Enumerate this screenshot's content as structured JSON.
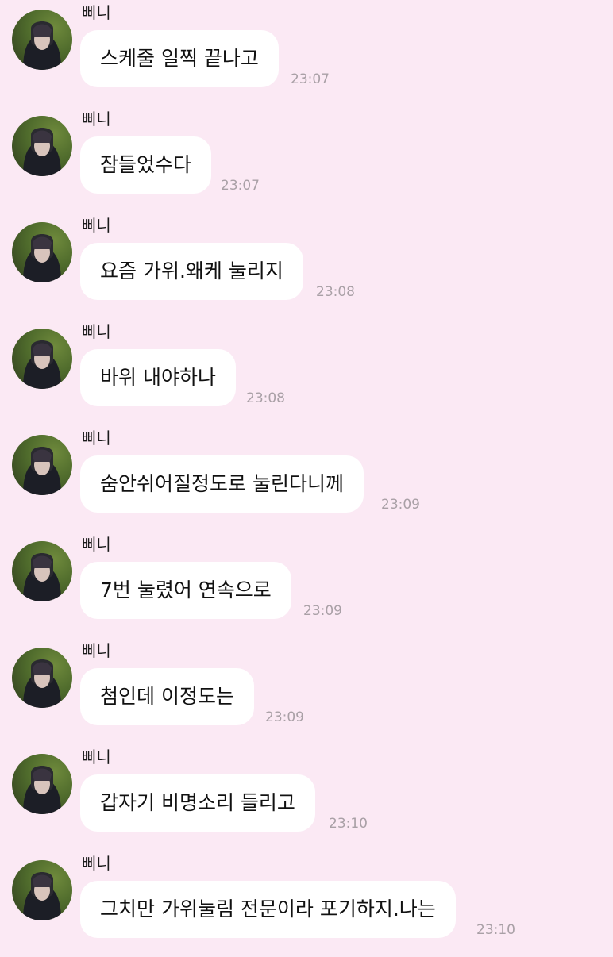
{
  "messages": [
    {
      "sender": "삐니",
      "text": "스케줄 일찍 끝나고",
      "time": "23:07"
    },
    {
      "sender": "삐니",
      "text": "잠들었수다",
      "time": "23:07"
    },
    {
      "sender": "삐니",
      "text": "요즘 가위.왜케 눌리지",
      "time": "23:08"
    },
    {
      "sender": "삐니",
      "text": "바위 내야하나",
      "time": "23:08"
    },
    {
      "sender": "삐니",
      "text": "숨안쉬어질정도로 눌린다니께",
      "time": "23:09"
    },
    {
      "sender": "삐니",
      "text": "7번 눌렸어 연속으로",
      "time": "23:09"
    },
    {
      "sender": "삐니",
      "text": "첨인데 이정도는",
      "time": "23:09"
    },
    {
      "sender": "삐니",
      "text": "갑자기 비명소리 들리고",
      "time": "23:10"
    },
    {
      "sender": "삐니",
      "text": "그치만 가위눌림 전문이라 포기하지.나는",
      "time": "23:10"
    }
  ],
  "colors": {
    "background": "#fbe9f4",
    "bubble": "#ffffff",
    "timestamp": "#a9a0a6"
  }
}
